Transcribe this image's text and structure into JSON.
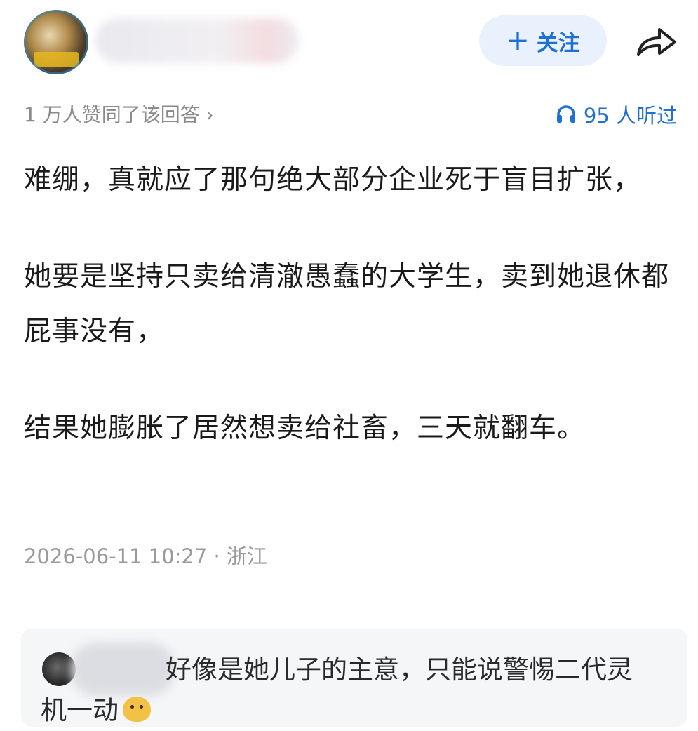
{
  "header": {
    "follow_label": "关注"
  },
  "meta": {
    "approval_text": "1 万人赞同了该回答 ›",
    "listen_text": "95 人听过"
  },
  "content": {
    "paragraphs": [
      "难绷，真就应了那句绝大部分企业死于盲目扩张，",
      "她要是坚持只卖给清澈愚蠢的大学生，卖到她退休都屁事没有，",
      "结果她膨胀了居然想卖给社畜，三天就翻车。"
    ]
  },
  "timestamp": "2026-06-11 10:27 · 浙江",
  "comment": {
    "text": "好像是她儿子的主意，只能说警惕二代灵机一动"
  },
  "colors": {
    "accent": "#1f6fd6",
    "follow_bg": "#e8f1fc",
    "muted": "#8a8a8a"
  },
  "icons": {
    "share": "share-arrow-icon",
    "listen": "headphones-icon",
    "follow": "plus-icon",
    "comment_emoji": "dog-emoji-icon"
  }
}
